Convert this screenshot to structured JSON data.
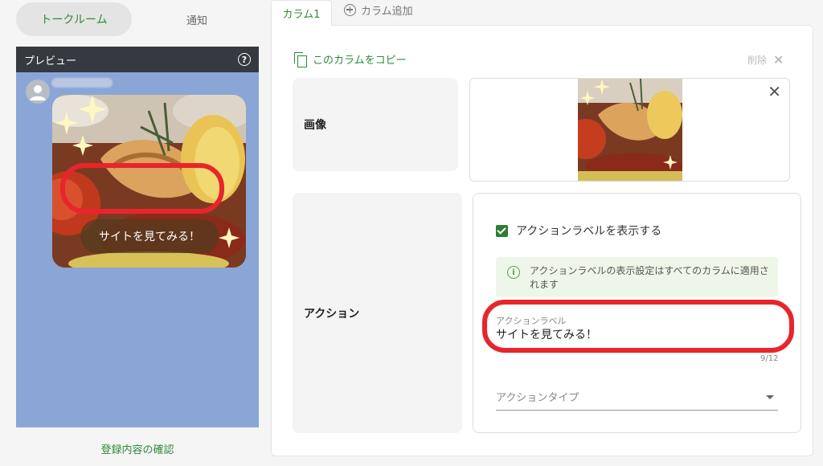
{
  "left_tabs": {
    "talk_room": "トークルーム",
    "notice": "通知"
  },
  "preview": {
    "title": "プレビュー",
    "help_icon": "?",
    "bubble_label": "サイトを見てみる！"
  },
  "confirm_link": "登録内容の確認",
  "column_tabs": {
    "column1": "カラム1",
    "add_column": "カラム追加"
  },
  "toolbar": {
    "copy_label": "このカラムをコピー",
    "delete_label": "削除",
    "delete_icon": "✕"
  },
  "image_section": {
    "label": "画像",
    "close_icon": "✕"
  },
  "action_section": {
    "label": "アクション",
    "show_label_checkbox": "アクションラベルを表示する",
    "show_label_checked": true,
    "info_icon": "i",
    "info_text": "アクションラベルの表示設定はすべてのカラムに適用されます",
    "label_field_title": "アクションラベル",
    "label_field_value": "サイトを見てみる！",
    "char_counter": "9/12",
    "type_placeholder": "アクションタイプ"
  },
  "colors": {
    "accent": "#2e8b3a",
    "preview_bg": "#8aa6d6",
    "highlight": "#e8252b",
    "checkbox": "#2e7d32"
  }
}
